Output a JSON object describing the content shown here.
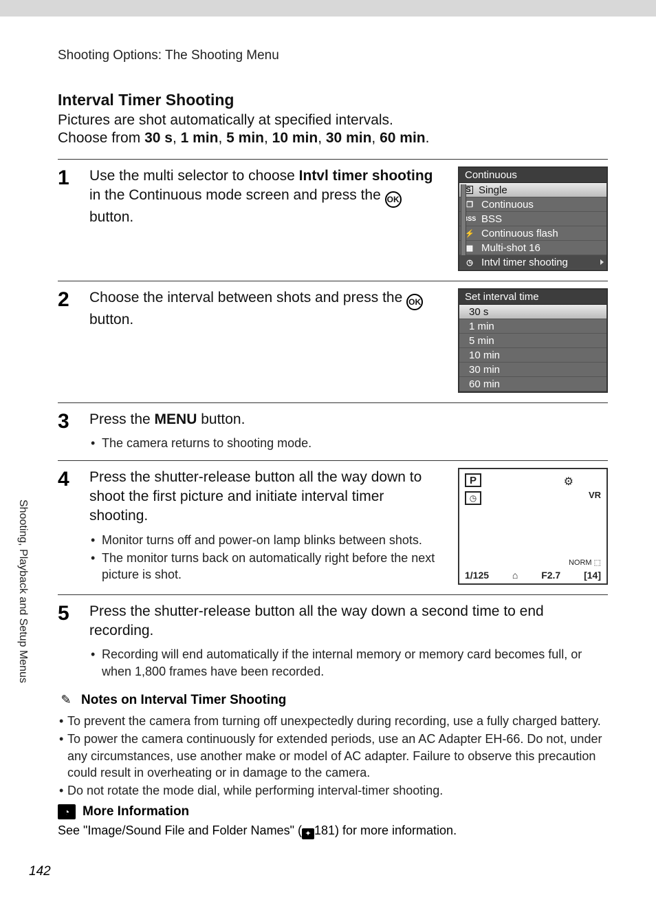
{
  "running_head": "Shooting Options: The Shooting Menu",
  "side_label": "Shooting, Playback and Setup Menus",
  "page_number": "142",
  "section_title": "Interval Timer Shooting",
  "intro_line": "Pictures are shot automatically at specified intervals.",
  "choose_prefix": "Choose from ",
  "choose_options": [
    "30 s",
    "1 min",
    "5 min",
    "10 min",
    "30 min",
    "60 min"
  ],
  "steps": {
    "s1": {
      "num": "1",
      "text_a": "Use the multi selector to choose ",
      "text_b": "Intvl timer shooting",
      "text_c": " in the Continuous mode screen and press the ",
      "text_d": " button."
    },
    "s2": {
      "num": "2",
      "text_a": "Choose the interval between shots and press the ",
      "text_b": " button."
    },
    "s3": {
      "num": "3",
      "text_a": "Press the ",
      "menu": "MENU",
      "text_b": " button.",
      "bullet1": "The camera returns to shooting mode."
    },
    "s4": {
      "num": "4",
      "text": "Press the shutter-release button all the way down to shoot the first picture and initiate interval timer shooting.",
      "bullet1": "Monitor turns off and power-on lamp blinks between shots.",
      "bullet2": "The monitor turns back on automatically right before the next picture is shot."
    },
    "s5": {
      "num": "5",
      "text": "Press the shutter-release button all the way down a second time to end recording.",
      "bullet1": "Recording will end automatically if the internal memory or memory card becomes full, or when 1,800 frames have been recorded."
    }
  },
  "cam_menu1": {
    "title": "Continuous",
    "items": [
      "Single",
      "Continuous",
      "BSS",
      "Continuous flash",
      "Multi-shot 16",
      "Intvl timer shooting"
    ]
  },
  "cam_menu2": {
    "title": "Set interval time",
    "items": [
      "30 s",
      "1 min",
      "5 min",
      "10 min",
      "30 min",
      "60 min"
    ]
  },
  "cam_disp": {
    "p": "P",
    "vr": "VR",
    "shutter": "1/125",
    "aperture": "F2.7",
    "count": "14",
    "norm": "NORM"
  },
  "notes": {
    "title": "Notes on Interval Timer Shooting",
    "b1": "To prevent the camera from turning off unexpectedly during recording, use a fully charged battery.",
    "b2": "To power the camera continuously for extended periods, use an AC Adapter EH-66. Do not, under any circumstances, use another make or model of AC adapter. Failure to observe this precaution could result in overheating or in damage to the camera.",
    "b3": "Do not rotate the mode dial, while performing interval-timer shooting."
  },
  "more": {
    "title": "More Information",
    "text_a": "See \"Image/Sound File and Folder Names\" (",
    "page": "181",
    "text_b": ") for more information."
  }
}
